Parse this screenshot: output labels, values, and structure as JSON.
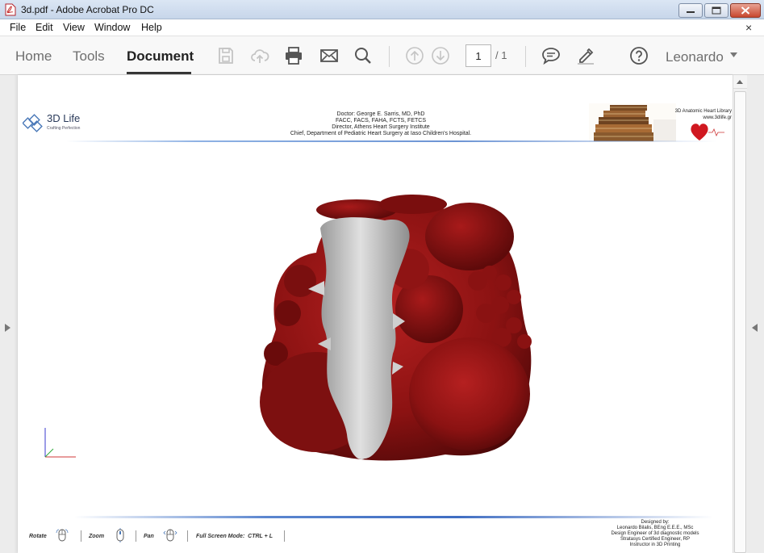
{
  "window": {
    "title": "3d.pdf - Adobe Acrobat Pro DC"
  },
  "menu": {
    "items": [
      "File",
      "Edit",
      "View",
      "Window",
      "Help"
    ],
    "close_glyph": "×"
  },
  "toolbar": {
    "tabs": [
      "Home",
      "Tools",
      "Document"
    ],
    "active_tab": "Document",
    "icons": [
      "save-icon",
      "cloud-upload-icon",
      "print-icon",
      "email-icon",
      "search-icon",
      "page-up-icon",
      "page-down-icon",
      "comment-icon",
      "highlight-pen-icon",
      "help-icon"
    ],
    "page_current": "1",
    "page_total": "/ 1",
    "user": "Leonardo"
  },
  "page": {
    "logo_name": "3D Life",
    "logo_tagline": "Crafting Perfection",
    "doctor_lines": [
      "Doctor: George E. Sarris, MD, PhD",
      "FACC, FACS, FAHA, FCTS, FETCS",
      "Director, Athens Heart Surgery Institute",
      "Chief, Department of Pediatric Heart Surgery at Iaso Children's Hospital."
    ],
    "library_title": "3D Anatomic Heart Library",
    "library_url": "www.3dlife.gr",
    "controls": {
      "rotate": "Rotate",
      "zoom": "Zoom",
      "pan": "Pan",
      "fullscreen": "Full Screen Mode:  CTRL + L"
    },
    "designed_by": [
      "Designed by:",
      "Leonardo Bilalis, BEng E.E.E., MSc",
      "Design Engineer of 3d diagnostic models",
      "Stratasys Certified Engineer, RP",
      "Instructor in 3D Printing"
    ]
  },
  "colors": {
    "heart": "#8b1212",
    "septum": "#c8c8c8",
    "header_rule": "#6c94d4"
  }
}
